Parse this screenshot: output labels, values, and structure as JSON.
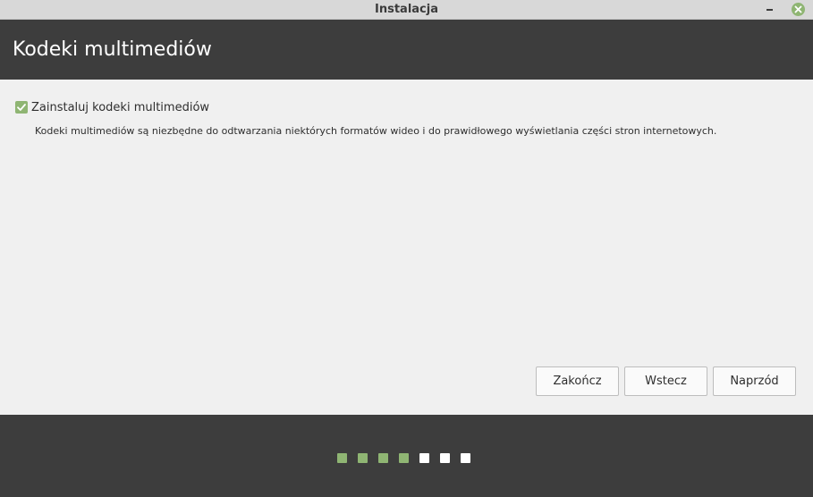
{
  "window": {
    "title": "Instalacja"
  },
  "header": {
    "title": "Kodeki multimediów"
  },
  "content": {
    "checkbox_label": "Zainstaluj kodeki multimediów",
    "checkbox_checked": true,
    "description": "Kodeki multimediów są niezbędne do odtwarzania niektórych formatów wideo i do prawidłowego wyświetlania części stron internetowych."
  },
  "buttons": {
    "finish_label": "Zakończ",
    "back_label": "Wstecz",
    "next_label": "Naprzód"
  },
  "progress": {
    "total_steps": 7,
    "completed_steps": 4
  },
  "colors": {
    "accent": "#8fb573",
    "header_bg": "#3d3d3d",
    "content_bg": "#f0f0f0"
  }
}
